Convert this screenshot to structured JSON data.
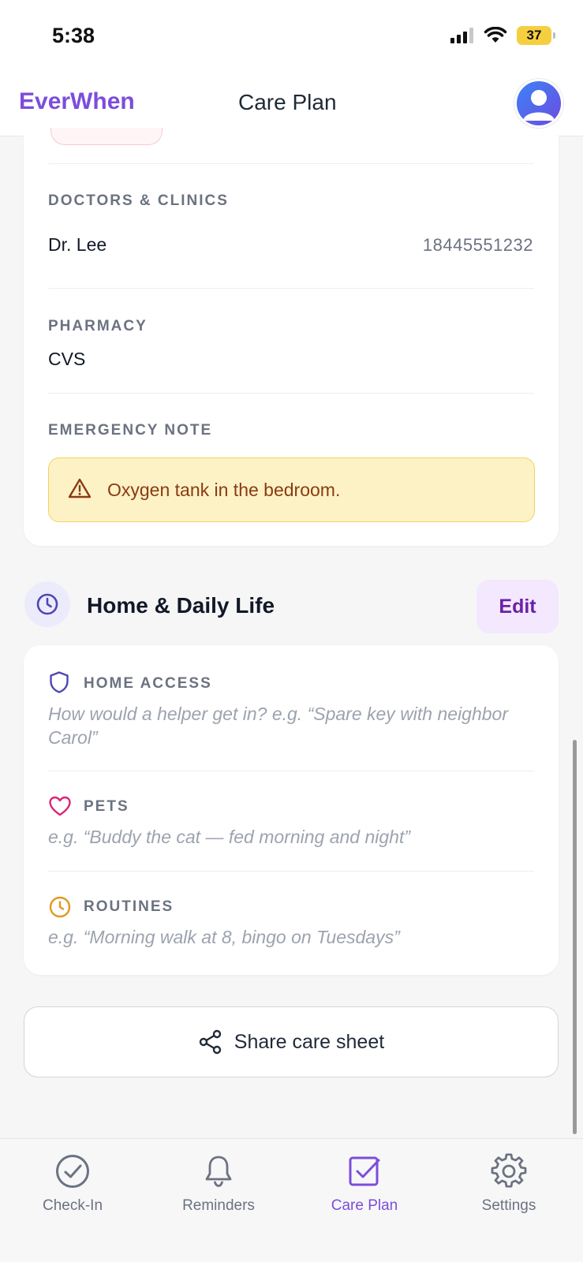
{
  "status_bar": {
    "time": "5:38",
    "battery": "37"
  },
  "app_bar": {
    "brand": "EverWhen",
    "title": "Care Plan"
  },
  "care_details": {
    "doctors": {
      "label": "DOCTORS & CLINICS",
      "name": "Dr. Lee",
      "phone": "18445551232"
    },
    "pharmacy": {
      "label": "PHARMACY",
      "name": "CVS"
    },
    "emergency": {
      "label": "EMERGENCY NOTE",
      "note": "Oxygen tank in the bedroom."
    }
  },
  "home_section": {
    "title": "Home & Daily Life",
    "edit_label": "Edit",
    "items": [
      {
        "label": "HOME ACCESS",
        "placeholder": "How would a helper get in? e.g. “Spare key with neighbor Carol”",
        "icon": "shield-icon",
        "color": "#4f46b5"
      },
      {
        "label": "PETS",
        "placeholder": "e.g. “Buddy the cat — fed morning and night”",
        "icon": "heart-icon",
        "color": "#db2777"
      },
      {
        "label": "ROUTINES",
        "placeholder": "e.g. “Morning walk at 8, bingo on Tuesdays”",
        "icon": "clock-icon",
        "color": "#e09a1f"
      }
    ]
  },
  "share": {
    "label": "Share care sheet"
  },
  "bottom_nav": {
    "items": [
      {
        "label": "Check-In",
        "icon": "check-circle-icon"
      },
      {
        "label": "Reminders",
        "icon": "bell-icon"
      },
      {
        "label": "Care Plan",
        "icon": "checkbox-icon",
        "active": true
      },
      {
        "label": "Settings",
        "icon": "gear-icon"
      }
    ]
  },
  "colors": {
    "accent": "#7c4ddb",
    "alert_bg": "#fdf2c6",
    "alert_text": "#8a3b12"
  }
}
